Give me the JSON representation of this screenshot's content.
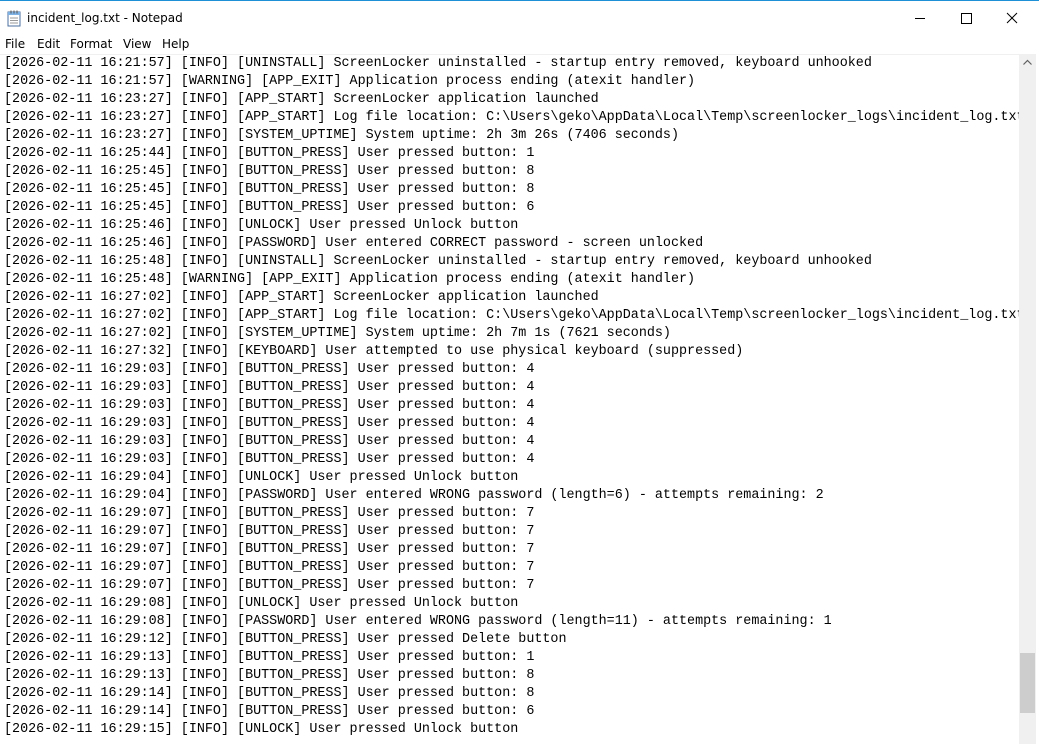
{
  "window": {
    "title": "incident_log.txt - Notepad"
  },
  "icons": {
    "app": "notepad-icon",
    "minimize": "minimize-icon",
    "maximize": "maximize-icon",
    "close": "close-icon",
    "scroll_up": "chevron-up-icon"
  },
  "menu": {
    "file": "File",
    "edit": "Edit",
    "format": "Format",
    "view": "View",
    "help": "Help"
  },
  "scrollbar": {
    "position_fraction": 0.95
  },
  "editor": {
    "lines": [
      "[2026-02-11 16:21:57] [INFO] [UNINSTALL] ScreenLocker uninstalled - startup entry removed, keyboard unhooked",
      "[2026-02-11 16:21:57] [WARNING] [APP_EXIT] Application process ending (atexit handler)",
      "[2026-02-11 16:23:27] [INFO] [APP_START] ScreenLocker application launched",
      "[2026-02-11 16:23:27] [INFO] [APP_START] Log file location: C:\\Users\\geko\\AppData\\Local\\Temp\\screenlocker_logs\\incident_log.txt",
      "[2026-02-11 16:23:27] [INFO] [SYSTEM_UPTIME] System uptime: 2h 3m 26s (7406 seconds)",
      "[2026-02-11 16:25:44] [INFO] [BUTTON_PRESS] User pressed button: 1",
      "[2026-02-11 16:25:45] [INFO] [BUTTON_PRESS] User pressed button: 8",
      "[2026-02-11 16:25:45] [INFO] [BUTTON_PRESS] User pressed button: 8",
      "[2026-02-11 16:25:45] [INFO] [BUTTON_PRESS] User pressed button: 6",
      "[2026-02-11 16:25:46] [INFO] [UNLOCK] User pressed Unlock button",
      "[2026-02-11 16:25:46] [INFO] [PASSWORD] User entered CORRECT password - screen unlocked",
      "[2026-02-11 16:25:48] [INFO] [UNINSTALL] ScreenLocker uninstalled - startup entry removed, keyboard unhooked",
      "[2026-02-11 16:25:48] [WARNING] [APP_EXIT] Application process ending (atexit handler)",
      "[2026-02-11 16:27:02] [INFO] [APP_START] ScreenLocker application launched",
      "[2026-02-11 16:27:02] [INFO] [APP_START] Log file location: C:\\Users\\geko\\AppData\\Local\\Temp\\screenlocker_logs\\incident_log.txt",
      "[2026-02-11 16:27:02] [INFO] [SYSTEM_UPTIME] System uptime: 2h 7m 1s (7621 seconds)",
      "[2026-02-11 16:27:32] [INFO] [KEYBOARD] User attempted to use physical keyboard (suppressed)",
      "[2026-02-11 16:29:03] [INFO] [BUTTON_PRESS] User pressed button: 4",
      "[2026-02-11 16:29:03] [INFO] [BUTTON_PRESS] User pressed button: 4",
      "[2026-02-11 16:29:03] [INFO] [BUTTON_PRESS] User pressed button: 4",
      "[2026-02-11 16:29:03] [INFO] [BUTTON_PRESS] User pressed button: 4",
      "[2026-02-11 16:29:03] [INFO] [BUTTON_PRESS] User pressed button: 4",
      "[2026-02-11 16:29:03] [INFO] [BUTTON_PRESS] User pressed button: 4",
      "[2026-02-11 16:29:04] [INFO] [UNLOCK] User pressed Unlock button",
      "[2026-02-11 16:29:04] [INFO] [PASSWORD] User entered WRONG password (length=6) - attempts remaining: 2",
      "[2026-02-11 16:29:07] [INFO] [BUTTON_PRESS] User pressed button: 7",
      "[2026-02-11 16:29:07] [INFO] [BUTTON_PRESS] User pressed button: 7",
      "[2026-02-11 16:29:07] [INFO] [BUTTON_PRESS] User pressed button: 7",
      "[2026-02-11 16:29:07] [INFO] [BUTTON_PRESS] User pressed button: 7",
      "[2026-02-11 16:29:07] [INFO] [BUTTON_PRESS] User pressed button: 7",
      "[2026-02-11 16:29:08] [INFO] [UNLOCK] User pressed Unlock button",
      "[2026-02-11 16:29:08] [INFO] [PASSWORD] User entered WRONG password (length=11) - attempts remaining: 1",
      "[2026-02-11 16:29:12] [INFO] [BUTTON_PRESS] User pressed Delete button",
      "[2026-02-11 16:29:13] [INFO] [BUTTON_PRESS] User pressed button: 1",
      "[2026-02-11 16:29:13] [INFO] [BUTTON_PRESS] User pressed button: 8",
      "[2026-02-11 16:29:14] [INFO] [BUTTON_PRESS] User pressed button: 8",
      "[2026-02-11 16:29:14] [INFO] [BUTTON_PRESS] User pressed button: 6",
      "[2026-02-11 16:29:15] [INFO] [UNLOCK] User pressed Unlock button"
    ]
  }
}
